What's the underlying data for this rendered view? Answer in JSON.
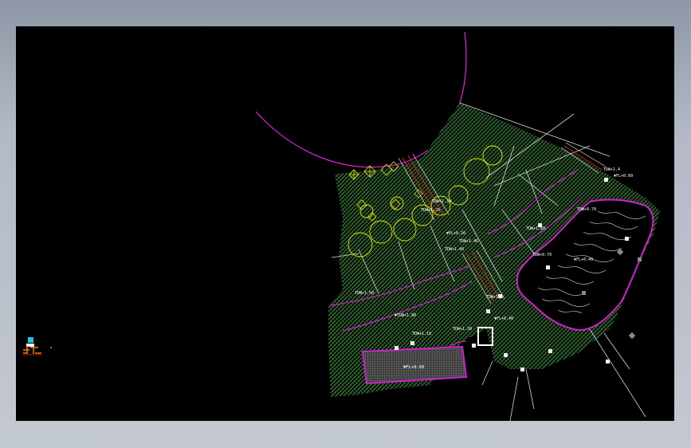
{
  "drawing": {
    "labels": {
      "tdw_top": "TDW+1.4",
      "fl_top_right": "▼FL+0.60",
      "tdw_mid_a": "TDW+1.34",
      "tdw_mid_b": "TDW+1.26",
      "fl_mid": "▼FL+0.20",
      "tdw_mid_c": "TDW+1.46",
      "tdw_mid_d": "TDW+1.46",
      "tdw_right_a": "TDW+1.80",
      "tdw_right_b": "TDW+0.70",
      "tdw_right_c": "TDW+0.70",
      "fl_pool": "▼FL+0.40",
      "tdw_left": "TDW+1.50",
      "tdw_left_b": "▼TDW+1.80",
      "tdw_center": "TDW+1.4",
      "tdw_lower": "TDW+1.10",
      "tdw_lower_b": "TDW+1.30",
      "fl_lower": "▼FL+0.40",
      "fl_terrace": "▼FL+0.60"
    }
  },
  "colors": {
    "canvas": "#000000",
    "hatch": "#3c8a3c",
    "wall": "#d11fd1",
    "tree": "#e6e600",
    "line": "#e6e6e6",
    "red": "#e21a1a"
  },
  "icons": {
    "ucs": "ucs-icon"
  }
}
